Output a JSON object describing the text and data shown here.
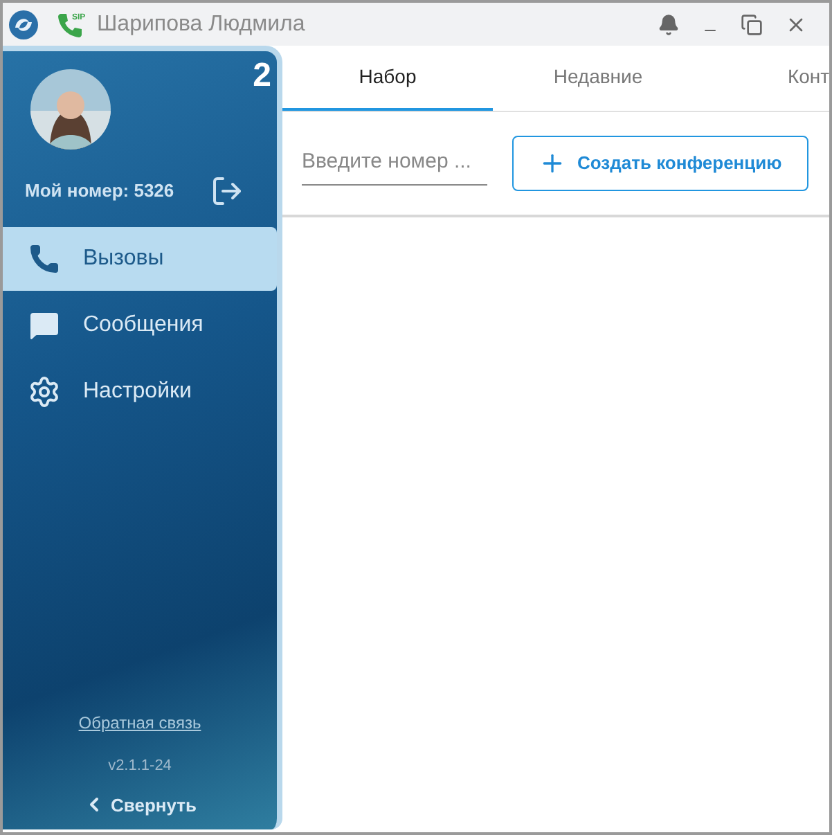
{
  "window": {
    "title": "Шарипова Людмила",
    "app_badge": "SIP"
  },
  "sidebar": {
    "badge": "2",
    "my_number": "Мой номер: 5326",
    "items": [
      {
        "label": "Вызовы",
        "kind": "calls",
        "selected": true
      },
      {
        "label": "Сообщения",
        "kind": "messages",
        "selected": false
      },
      {
        "label": "Настройки",
        "kind": "settings",
        "selected": false
      }
    ],
    "feedback_link": "Обратная связь",
    "version": "v2.1.1-24",
    "collapse": "Свернуть"
  },
  "tabs": [
    {
      "label": "Набор",
      "selected": true
    },
    {
      "label": "Недавние",
      "selected": false
    },
    {
      "label": "Конт",
      "selected": false
    }
  ],
  "search": {
    "placeholder": "Введите номер ..."
  },
  "create_button": "Создать конференцию"
}
